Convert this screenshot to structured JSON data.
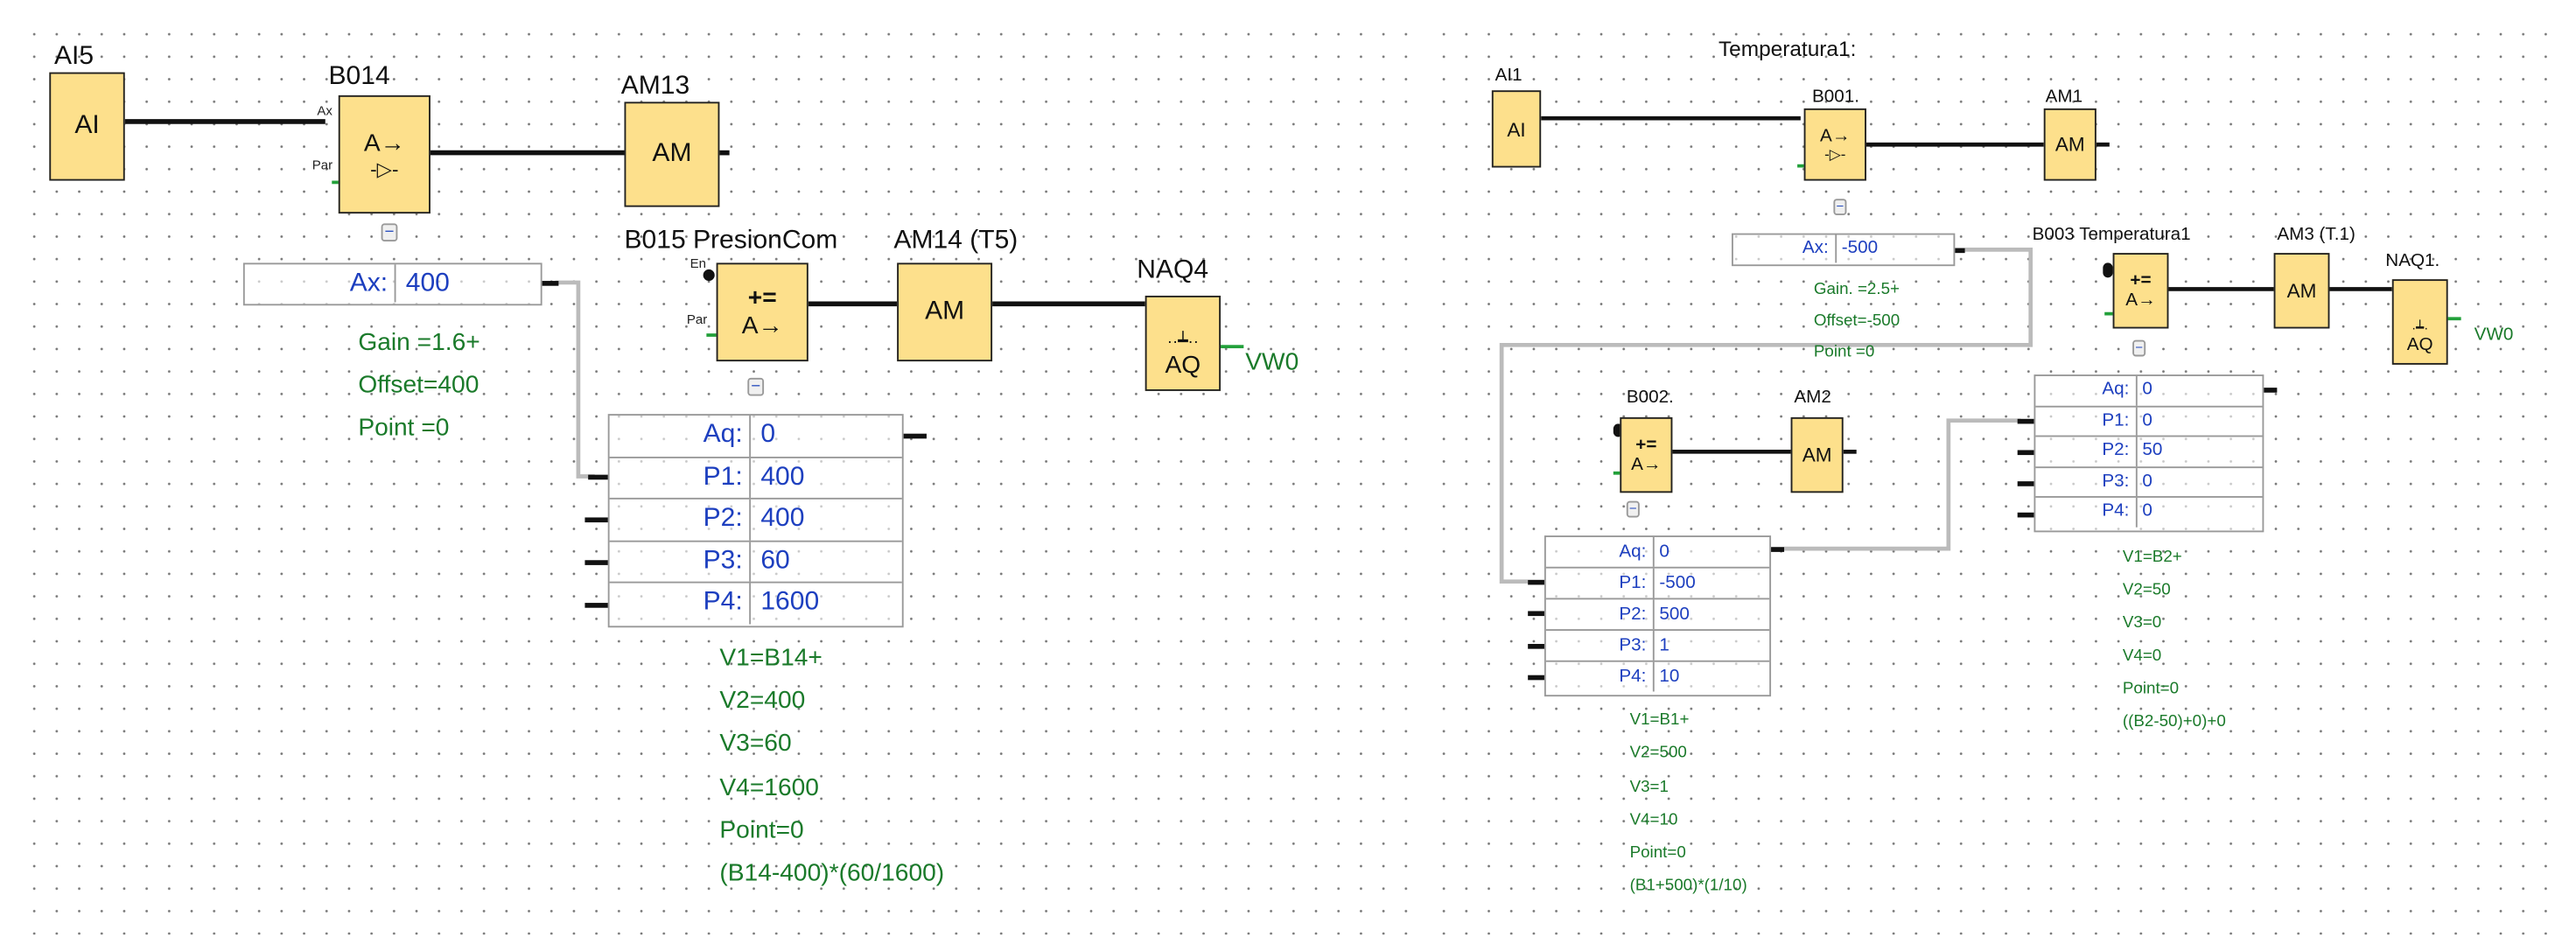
{
  "left": {
    "ai5": {
      "label": "AI5",
      "symbol": "AI"
    },
    "b014": {
      "label": "B014",
      "symbol_top": "A→",
      "symbol_bottom": "-▷-",
      "pin_ax": "Ax",
      "pin_par": "Par"
    },
    "am13": {
      "label": "AM13",
      "symbol": "AM"
    },
    "b014_param": {
      "name": "Ax:",
      "value": "400",
      "lines": [
        "Gain  =1.6+",
        "Offset=400",
        "Point =0"
      ]
    },
    "b015": {
      "label": "B015 PresionCom",
      "symbol_top": "+=",
      "symbol_bottom": "A→",
      "pin_en": "En",
      "pin_par": "Par"
    },
    "am14": {
      "label": "AM14  (T5)",
      "symbol": "AM"
    },
    "naq4": {
      "label": "NAQ4",
      "symbol": "AQ",
      "output": "VW0"
    },
    "b015_table": [
      {
        "name": "Aq:",
        "value": "0"
      },
      {
        "name": "P1:",
        "value": "400"
      },
      {
        "name": "P2:",
        "value": "400"
      },
      {
        "name": "P3:",
        "value": "60"
      },
      {
        "name": "P4:",
        "value": "1600"
      }
    ],
    "b015_formula": [
      "V1=B14+",
      "V2=400",
      "V3=60",
      "V4=1600",
      "Point=0",
      "(B14-400)*(60/1600)"
    ]
  },
  "right": {
    "title": "Temperatura1:",
    "ai1": {
      "label": "AI1",
      "symbol": "AI"
    },
    "b001": {
      "label": "B001.",
      "symbol_top": "A→",
      "symbol_bottom": "-▷-"
    },
    "am1": {
      "label": "AM1",
      "symbol": "AM"
    },
    "b001_param": {
      "name": "Ax:",
      "value": "-500",
      "lines": [
        "Gain. =2.5+",
        "Offset=-500",
        "Point =0"
      ]
    },
    "b003": {
      "label": "B003 Temperatura1",
      "symbol_top": "+=",
      "symbol_bottom": "A→"
    },
    "am3": {
      "label": "AM3 (T.1)",
      "symbol": "AM"
    },
    "naq1": {
      "label": "NAQ1.",
      "symbol": "AQ",
      "output": "VW0"
    },
    "b003_table": [
      {
        "name": "Aq:",
        "value": "0"
      },
      {
        "name": "P1:",
        "value": "0"
      },
      {
        "name": "P2:",
        "value": "50"
      },
      {
        "name": "P3:",
        "value": "0"
      },
      {
        "name": "P4:",
        "value": "0"
      }
    ],
    "b003_formula": [
      "V1=B2+",
      "V2=50",
      "V3=0",
      "V4=0",
      "Point=0",
      "((B2-50)+0)+0"
    ],
    "b002": {
      "label": "B002.",
      "symbol_top": "+=",
      "symbol_bottom": "A→"
    },
    "am2": {
      "label": "AM2",
      "symbol": "AM"
    },
    "b002_table": [
      {
        "name": "Aq:",
        "value": "0"
      },
      {
        "name": "P1:",
        "value": "-500"
      },
      {
        "name": "P2:",
        "value": "500"
      },
      {
        "name": "P3:",
        "value": "1"
      },
      {
        "name": "P4:",
        "value": "10"
      }
    ],
    "b002_formula": [
      "V1=B1+",
      "V2=500",
      "V3=1",
      "V4=10",
      "Point=0",
      "(B1+500)*(1/10)"
    ]
  },
  "colors": {
    "block_fill": "#fde08c",
    "param_text": "#1d3fbf",
    "formula_text": "#1a7a2a"
  }
}
